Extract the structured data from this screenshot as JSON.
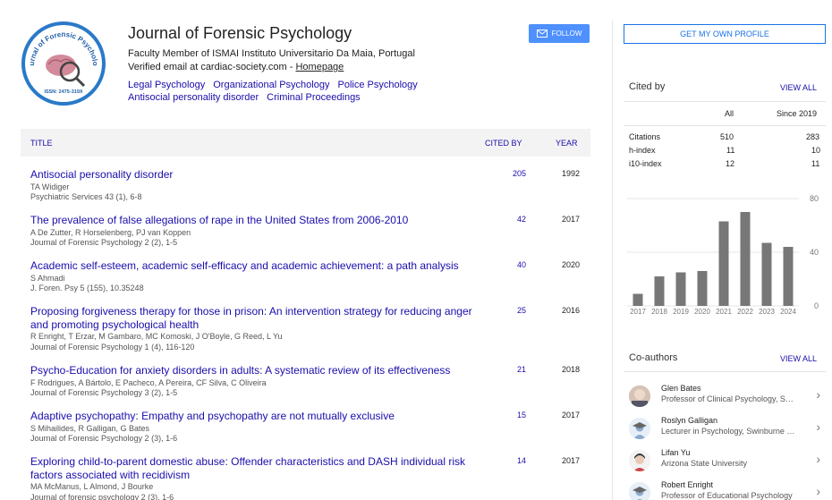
{
  "profile": {
    "name": "Journal of Forensic Psychology",
    "affiliation": "Faculty Member of ISMAI Instituto Universitario Da Maia, Portugal",
    "email_text": "Verified email at cardiac-society.com - ",
    "homepage_label": "Homepage",
    "interests": [
      "Legal Psychology",
      "Organizational Psychology",
      "Police Psychology",
      "Antisocial personality disorder",
      "Criminal Proceedings"
    ],
    "logo_text": "Journal of Forensic Psychology",
    "logo_issn": "ISSN: 2475-319X"
  },
  "follow_label": "FOLLOW",
  "table": {
    "headers": {
      "title": "TITLE",
      "cited_by": "CITED BY",
      "year": "YEAR"
    },
    "rows": [
      {
        "title": "Antisocial personality disorder",
        "authors": "TA Widiger",
        "journal": "Psychiatric Services 43 (1), 6-8",
        "cited": "205",
        "year": "1992"
      },
      {
        "title": "The prevalence of false allegations of rape in the United States from 2006-2010",
        "authors": "A De Zutter, R Horselenberg, PJ van Koppen",
        "journal": "Journal of Forensic Psychology 2 (2), 1-5",
        "cited": "42",
        "year": "2017"
      },
      {
        "title": "Academic self-esteem, academic self-efficacy and academic achievement: a path analysis",
        "authors": "S Ahmadi",
        "journal": "J. Foren. Psy 5 (155), 10.35248",
        "cited": "40",
        "year": "2020"
      },
      {
        "title": "Proposing forgiveness therapy for those in prison: An intervention strategy for reducing anger and promoting psychological health",
        "authors": "R Enright, T Erzar, M Gambaro, MC Komoski, J O'Boyle, G Reed, L Yu",
        "journal": "Journal of Forensic Psychology 1 (4), 116-120",
        "cited": "25",
        "year": "2016"
      },
      {
        "title": "Psycho-Education for anxiety disorders in adults: A systematic review of its effectiveness",
        "authors": "F Rodrigues, A Bártolo, E Pacheco, A Pereira, CF Silva, C Oliveira",
        "journal": "Journal of Forensic Psychology 3 (2), 1-5",
        "cited": "21",
        "year": "2018"
      },
      {
        "title": "Adaptive psychopathy: Empathy and psychopathy are not mutually exclusive",
        "authors": "S Mihailides, R Galligan, G Bates",
        "journal": "Journal of Forensic Psychology 2 (3), 1-6",
        "cited": "15",
        "year": "2017"
      },
      {
        "title": "Exploring child-to-parent domestic abuse: Offender characteristics and DASH individual risk factors associated with recidivism",
        "authors": "MA McManus, L Almond, J Bourke",
        "journal": "Journal of forensic psychology 2 (3), 1-6",
        "cited": "14",
        "year": "2017"
      }
    ]
  },
  "right": {
    "own_profile_label": "GET MY OWN PROFILE",
    "cited_by_heading": "Cited by",
    "view_all": "VIEW ALL",
    "stats_headers": {
      "all": "All",
      "since": "Since 2019"
    },
    "stats": [
      {
        "label": "Citations",
        "all": "510",
        "since": "283"
      },
      {
        "label": "h-index",
        "all": "11",
        "since": "10"
      },
      {
        "label": "i10-index",
        "all": "12",
        "since": "11"
      }
    ],
    "coauthors_heading": "Co-authors",
    "coauthors": [
      {
        "name": "Glen Bates",
        "desc": "Professor of Clinical Psychology, Swinburne University",
        "avatar": "photo"
      },
      {
        "name": "Roslyn Galligan",
        "desc": "Lecturer in Psychology, Swinburne University",
        "avatar": "placeholder"
      },
      {
        "name": "Lifan Yu",
        "desc": "Arizona State University",
        "avatar": "photo"
      },
      {
        "name": "Robert Enright",
        "desc": "Professor of Educational Psychology",
        "avatar": "placeholder"
      }
    ]
  },
  "chart_data": {
    "type": "bar",
    "categories": [
      "2017",
      "2018",
      "2019",
      "2020",
      "2021",
      "2022",
      "2023",
      "2024"
    ],
    "values": [
      9,
      22,
      25,
      26,
      63,
      70,
      47,
      44
    ],
    "yticks": [
      "80",
      "40",
      "0"
    ],
    "ylim": [
      0,
      80
    ],
    "color": "#777777"
  }
}
